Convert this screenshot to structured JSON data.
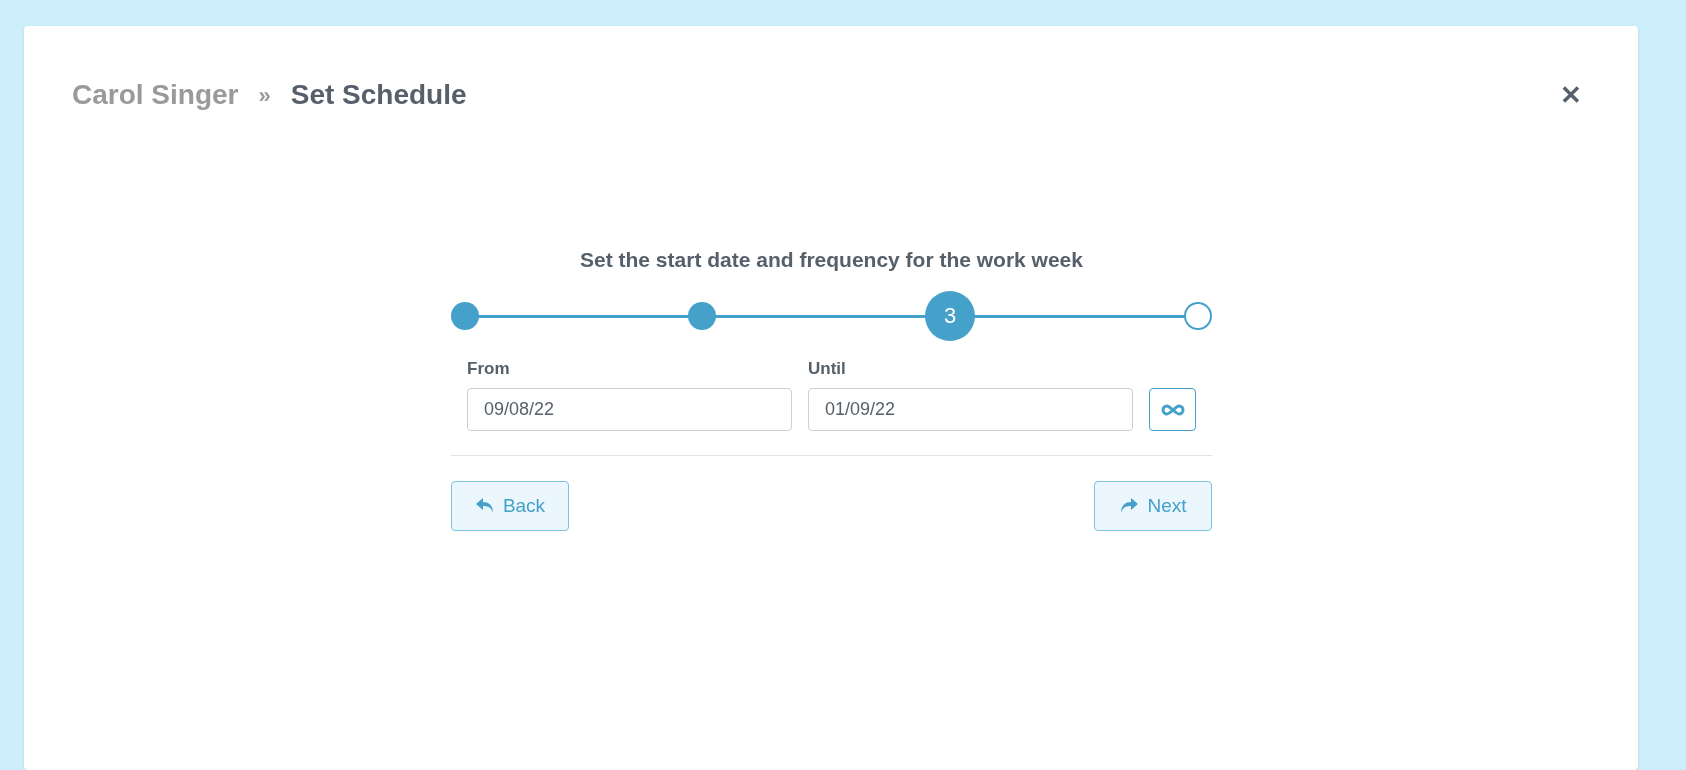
{
  "breadcrumb": {
    "parent": "Carol Singer",
    "separator": "»",
    "current": "Set Schedule"
  },
  "close": "✕",
  "heading": "Set the start date and frequency for the work week",
  "steps": [
    {
      "kind": "done"
    },
    {
      "kind": "done"
    },
    {
      "kind": "current",
      "label": "3"
    },
    {
      "kind": "upcoming"
    }
  ],
  "fields": [
    {
      "label": "From",
      "value": "09/08/22"
    },
    {
      "label": "Until",
      "value": "01/09/22"
    }
  ],
  "buttons": [
    {
      "kind": "back",
      "label": "Back"
    },
    {
      "kind": "next",
      "label": "Next"
    }
  ]
}
